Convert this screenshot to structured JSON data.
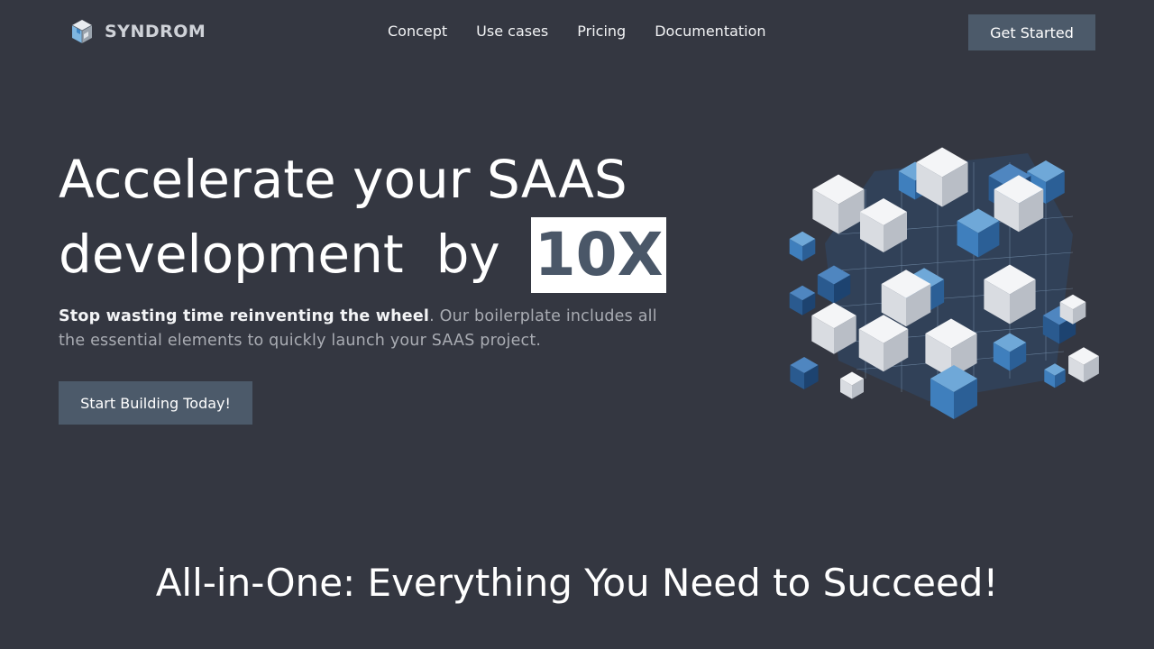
{
  "brand": {
    "name": "SYNDROM",
    "logo_icon": "cube-logo-icon"
  },
  "nav": {
    "links": [
      "Concept",
      "Use cases",
      "Pricing",
      "Documentation"
    ],
    "cta_label": "Get Started"
  },
  "hero": {
    "title_line1": "Accelerate your SAAS",
    "title_line2_word1": "development",
    "title_line2_word2": "by",
    "highlight": "10X",
    "subtitle_bold": "Stop wasting time reinventing the wheel",
    "subtitle_rest": ". Our boilerplate includes all the essential elements to quickly launch your SAAS project.",
    "cta_label": "Start Building Today!",
    "illustration": "cubes-illustration"
  },
  "section": {
    "title": "All-in-One: Everything You Need to Succeed!"
  },
  "colors": {
    "background": "#343741",
    "button": "#4c5a6a",
    "highlight_text": "#4a5768",
    "muted_text": "#a9acb3"
  }
}
